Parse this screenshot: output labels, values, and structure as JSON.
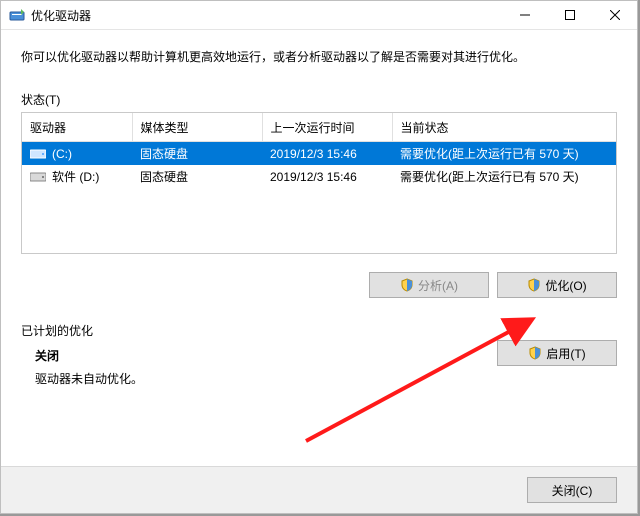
{
  "window": {
    "title": "优化驱动器"
  },
  "description": "你可以优化驱动器以帮助计算机更高效地运行，或者分析驱动器以了解是否需要对其进行优化。",
  "status_label": "状态(T)",
  "table": {
    "headers": {
      "drive": "驱动器",
      "media": "媒体类型",
      "last_run": "上一次运行时间",
      "current": "当前状态"
    },
    "rows": [
      {
        "name": "(C:)",
        "media": "固态硬盘",
        "last_run": "2019/12/3 15:46",
        "status": "需要优化(距上次运行已有 570 天)"
      },
      {
        "name": "软件 (D:)",
        "media": "固态硬盘",
        "last_run": "2019/12/3 15:46",
        "status": "需要优化(距上次运行已有 570 天)"
      }
    ]
  },
  "buttons": {
    "analyze": "分析(A)",
    "optimize": "优化(O)",
    "enable": "启用(T)",
    "close": "关闭(C)"
  },
  "scheduled": {
    "heading": "已计划的优化",
    "status": "关闭",
    "note": "驱动器未自动优化。"
  }
}
